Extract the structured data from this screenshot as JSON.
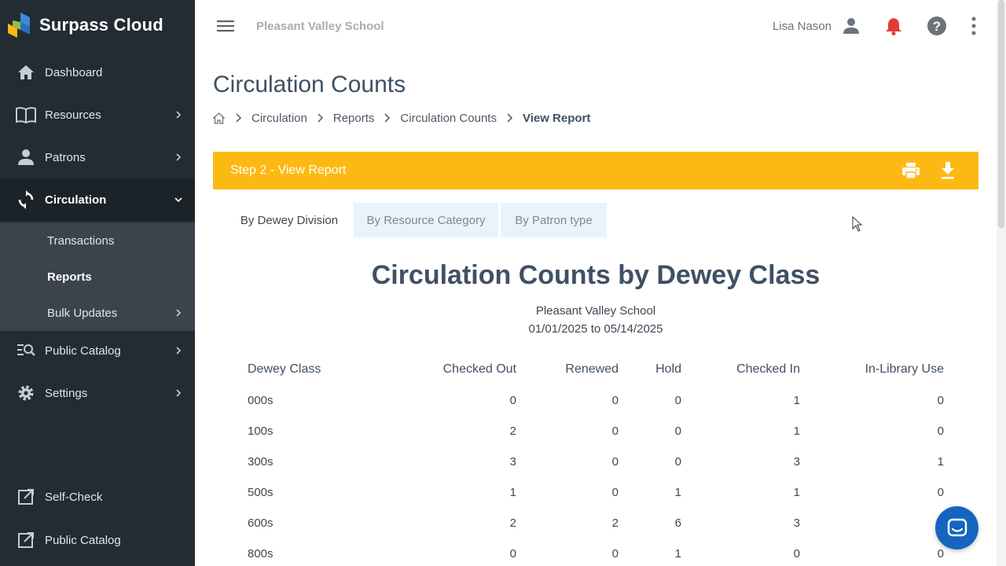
{
  "app": {
    "name": "Surpass Cloud"
  },
  "sidebar": {
    "items": [
      {
        "label": "Dashboard",
        "icon": "home-icon"
      },
      {
        "label": "Resources",
        "icon": "book-icon"
      },
      {
        "label": "Patrons",
        "icon": "person-icon"
      },
      {
        "label": "Circulation",
        "icon": "sync-icon",
        "active": true
      },
      {
        "label": "Public Catalog",
        "icon": "catalog-search-icon"
      },
      {
        "label": "Settings",
        "icon": "gear-icon"
      },
      {
        "label": "Self-Check",
        "icon": "external-link-icon"
      },
      {
        "label": "Public Catalog",
        "icon": "external-link-icon"
      }
    ],
    "subitems": [
      {
        "label": "Transactions"
      },
      {
        "label": "Reports",
        "active": true
      },
      {
        "label": "Bulk Updates"
      }
    ]
  },
  "topbar": {
    "school": "Pleasant Valley School",
    "user": "Lisa Nason"
  },
  "page": {
    "title": "Circulation Counts",
    "breadcrumb": [
      "Circulation",
      "Reports",
      "Circulation Counts",
      "View Report"
    ]
  },
  "step": {
    "label": "Step 2 - View Report"
  },
  "tabs": [
    "By Dewey Division",
    "By Resource Category",
    "By Patron type"
  ],
  "report": {
    "title": "Circulation Counts by Dewey Class",
    "school": "Pleasant Valley School",
    "date_range": "01/01/2025 to 05/14/2025",
    "headers": [
      "Dewey Class",
      "Checked Out",
      "Renewed",
      "Hold",
      "Checked In",
      "In-Library Use"
    ],
    "rows": [
      [
        "000s",
        "0",
        "0",
        "0",
        "1",
        "0"
      ],
      [
        "100s",
        "2",
        "0",
        "0",
        "1",
        "0"
      ],
      [
        "300s",
        "3",
        "0",
        "0",
        "3",
        "1"
      ],
      [
        "500s",
        "1",
        "0",
        "1",
        "1",
        "0"
      ],
      [
        "600s",
        "2",
        "2",
        "6",
        "3",
        ""
      ],
      [
        "800s",
        "0",
        "0",
        "1",
        "0",
        "0"
      ]
    ]
  },
  "colors": {
    "sidebar_bg": "#232b33",
    "accent_yellow": "#fdb913",
    "title_blue": "#3f5064",
    "notification_red": "#e53935",
    "chat_blue": "#1565c0"
  }
}
